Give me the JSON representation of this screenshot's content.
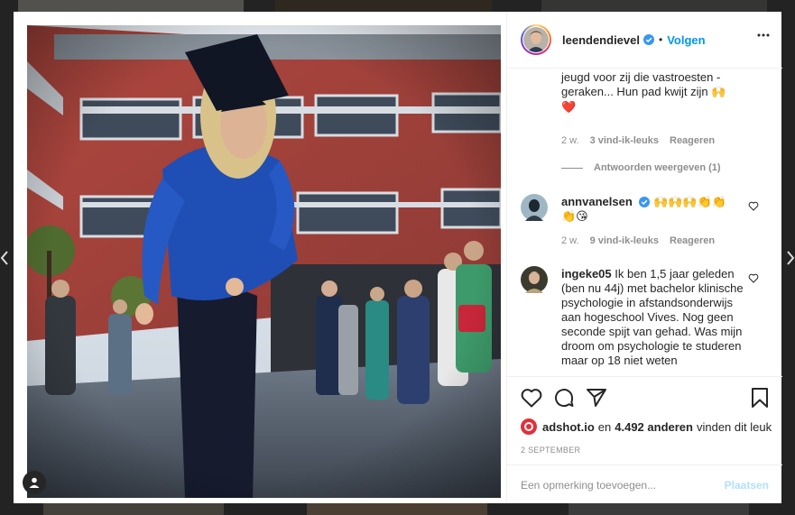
{
  "post": {
    "author": "leendendievel",
    "follow_label": "Volgen",
    "more_icon": "more-dots-icon",
    "verified_color": "#3897f0"
  },
  "comments": {
    "caption_tail": "jeugd voor zij die vastroesten - geraken... Hun pad kwijt zijn 🙌",
    "caption_heart": "❤️",
    "caption_meta": {
      "time": "2 w.",
      "likes": "3 vind-ik-leuks",
      "reply": "Reageren"
    },
    "view_replies": "Antwoorden weergeven (1)",
    "items": [
      {
        "user": "annvanelsen",
        "text": "🙌🙌🙌👏👏 👏😘",
        "time": "2 w.",
        "likes": "9 vind-ik-leuks",
        "reply": "Reageren"
      },
      {
        "user": "ingeke05",
        "text": "Ik ben 1,5 jaar geleden (ben nu 44j) met bachelor klinische psychologie in afstandsonderwijs aan hogeschool Vives. Nog geen seconde spijt van gehad. Was mijn droom om psychologie te studeren maar op 18 niet weten"
      }
    ]
  },
  "likes": {
    "user": "adshot.io",
    "connector": "en",
    "count": "4.492 anderen",
    "suffix": "vinden dit leuk"
  },
  "date": "2 SEPTEMBER",
  "comment_box": {
    "placeholder": "Een opmerking toevoegen...",
    "post_label": "Plaatsen"
  },
  "colors": {
    "accent": "#0095f6",
    "post_disabled": "#b2dffc",
    "heart_red": "#ed4956"
  }
}
